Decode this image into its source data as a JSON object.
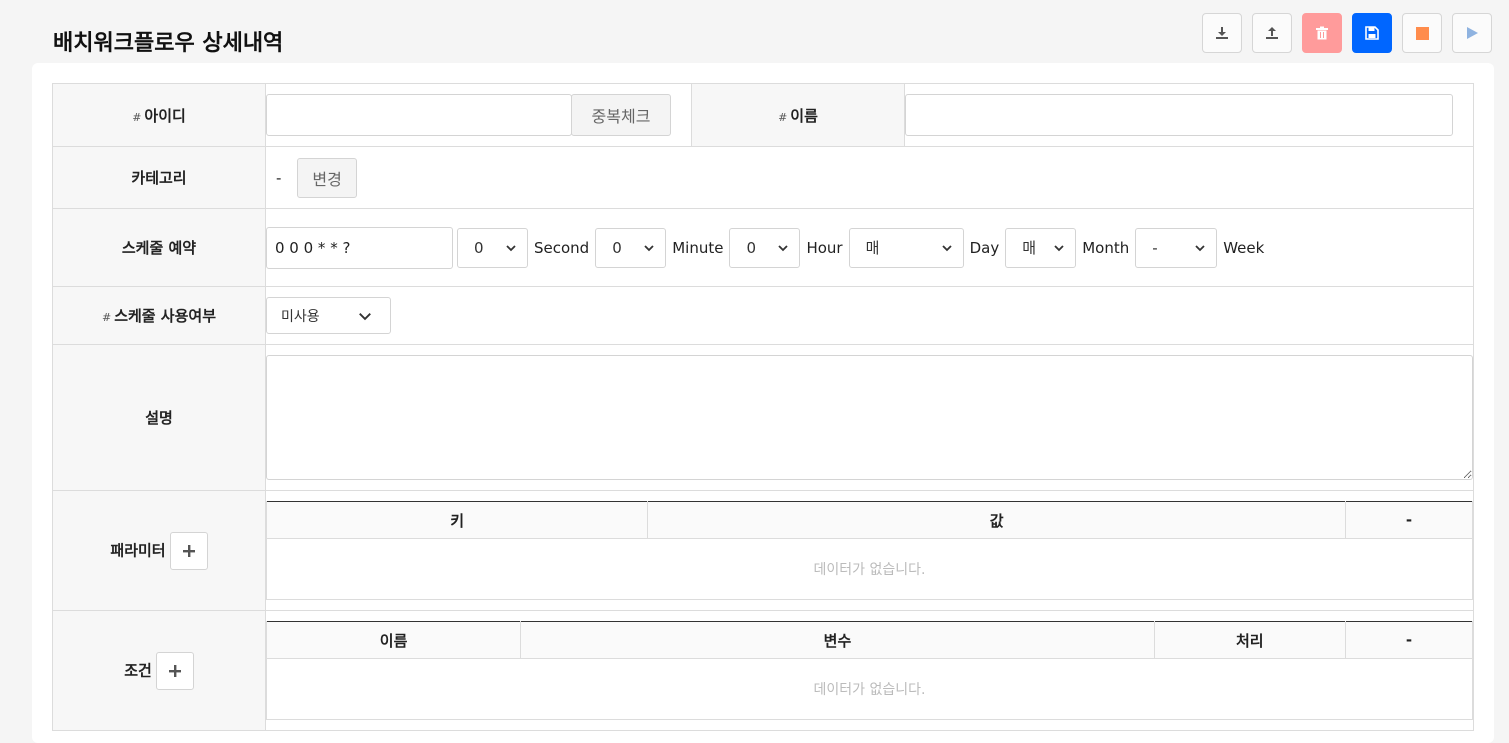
{
  "page": {
    "title": "배치워크플로우 상세내역"
  },
  "toolbar": {
    "colors": {
      "delete": "#ff9b9b",
      "save": "#0066ff",
      "stop": "#ff8c4c",
      "run": "#8fb3e0"
    },
    "icons": [
      "download-icon",
      "upload-icon",
      "trash-icon",
      "floppy-disk-icon",
      "stop-icon",
      "play-icon"
    ]
  },
  "form": {
    "id": {
      "hash": "#",
      "label": "아이디",
      "value": "",
      "check_button": "중복체크"
    },
    "name": {
      "hash": "#",
      "label": "이름",
      "value": ""
    },
    "category": {
      "label": "카테고리",
      "value": "-",
      "change_button": "변경"
    },
    "schedule": {
      "label": "스케줄 예약",
      "cron": "0 0 0 * * ?",
      "second": {
        "value": "0",
        "unit": "Second"
      },
      "minute": {
        "value": "0",
        "unit": "Minute"
      },
      "hour": {
        "value": "0",
        "unit": "Hour"
      },
      "day": {
        "value": "매",
        "unit": "Day"
      },
      "month": {
        "value": "매",
        "unit": "Month"
      },
      "week": {
        "value": "-",
        "unit": "Week"
      }
    },
    "schedule_use": {
      "hash": "#",
      "label": "스케줄 사용여부",
      "value": "미사용"
    },
    "description": {
      "label": "설명",
      "value": ""
    },
    "parameters": {
      "label": "패라미터",
      "columns": [
        "키",
        "값",
        "-"
      ],
      "empty_text": "데이터가 없습니다."
    },
    "conditions": {
      "label": "조건",
      "columns": [
        "이름",
        "변수",
        "처리",
        "-"
      ],
      "empty_text": "데이터가 없습니다."
    }
  }
}
